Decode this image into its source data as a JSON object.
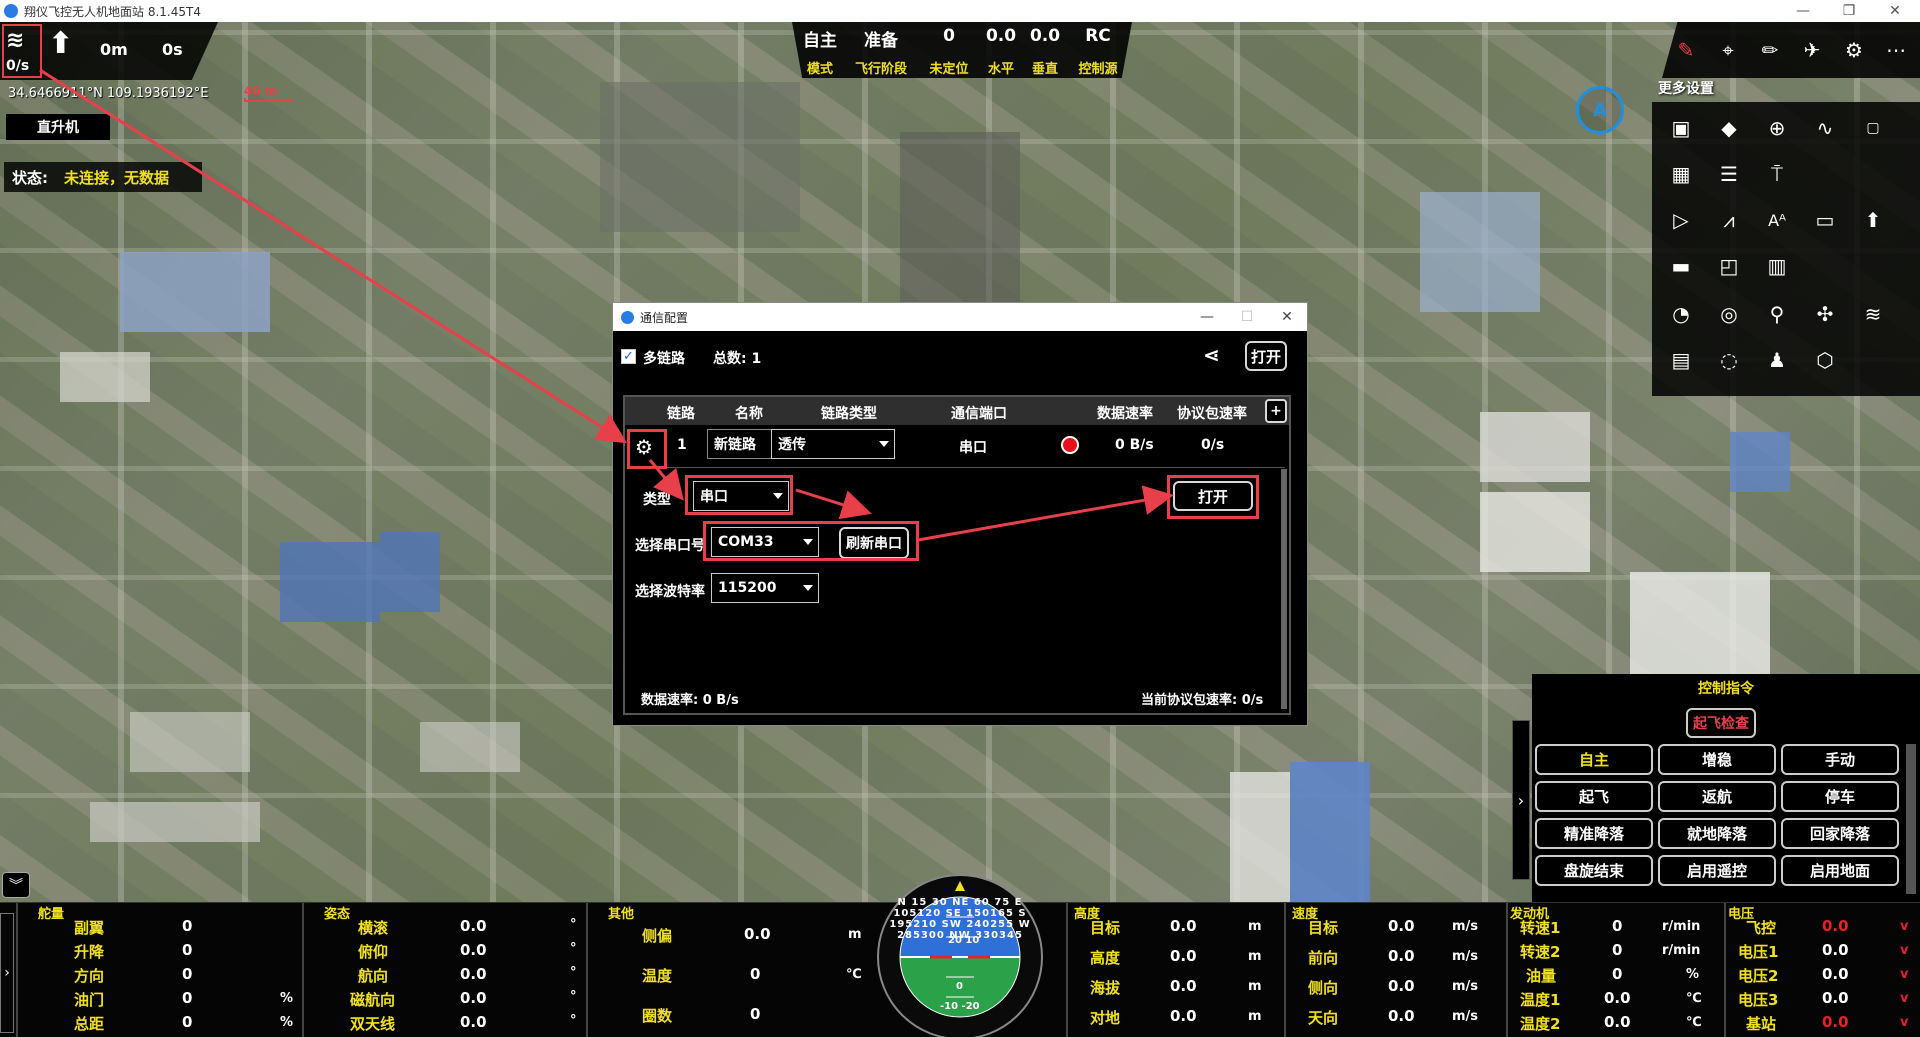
{
  "window": {
    "title": "翔仪飞控无人机地面站 8.1.45T4",
    "minimize": "—",
    "restore": "❐",
    "close": "✕"
  },
  "topleft": {
    "link_rate": "0/s",
    "altitude": "0m",
    "time": "0s",
    "coords": "34.6466911°N 109.1936192°E",
    "scale": "40 m",
    "vehicle_type": "直升机",
    "status_label": "状态:",
    "status_value": "未连接，无数据"
  },
  "topcenter": {
    "items": [
      {
        "value": "自主",
        "label": "模式"
      },
      {
        "value": "准备",
        "label": "飞行阶段"
      },
      {
        "value": "0",
        "label": "未定位"
      },
      {
        "value": "0.0",
        "label": "水平"
      },
      {
        "value": "0.0",
        "label": "垂直"
      },
      {
        "value": "RC",
        "label": "控制源"
      }
    ]
  },
  "topright": {
    "more_settings": "更多设置",
    "compass_letter": "A",
    "icon_rows": [
      [
        "settings-chip-icon",
        "diamond-icon",
        "crosshair-icon",
        "waveform-icon",
        "fc-icon"
      ],
      [
        "table-icon",
        "list-icon",
        "antenna-icon"
      ],
      [
        "play-icon",
        "chart-line-icon",
        "text-size-icon",
        "monitor-icon",
        "upload-icon"
      ],
      [
        "battery-icon",
        "screen-icon",
        "bar-chart-icon"
      ],
      [
        "gauge-icon",
        "signal-icon",
        "location-icon",
        "drone-icon",
        "wireless-icon"
      ],
      [
        "window-icon",
        "chat-icon",
        "person-icon",
        "box-icon"
      ]
    ]
  },
  "dialog": {
    "title": "通信配置",
    "multi_link_label": "多链路",
    "multi_link_checked": true,
    "total_label": "总数: 1",
    "open_button": "打开",
    "table": {
      "headers": [
        "链路",
        "名称",
        "链路类型",
        "通信端口",
        "数据速率",
        "协议包速率"
      ],
      "add_button": "+",
      "row": {
        "index": "1",
        "name": "新链路",
        "link_type": "透传",
        "port": "串口",
        "data_rate": "0 B/s",
        "packet_rate": "0/s"
      }
    },
    "settings": {
      "type_label": "类型",
      "type_value": "串口",
      "port_label": "选择串口号",
      "port_value": "COM33",
      "refresh_button": "刷新串口",
      "baud_label": "选择波特率",
      "baud_value": "115200",
      "open_button": "打开"
    },
    "footer": {
      "data_rate": "数据速率: 0 B/s",
      "packet_rate": "当前协议包速率: 0/s"
    }
  },
  "control": {
    "title": "控制指令",
    "check_button": "起飞检查",
    "buttons": [
      "自主",
      "增稳",
      "手动",
      "起飞",
      "返航",
      "停车",
      "精准降落",
      "就地降落",
      "回家降落",
      "盘旋结束",
      "启用遥控",
      "启用地面"
    ]
  },
  "telemetry": {
    "rudder": {
      "title": "舵量",
      "rows": [
        {
          "label": "副翼",
          "value": "0",
          "unit": ""
        },
        {
          "label": "升降",
          "value": "0",
          "unit": ""
        },
        {
          "label": "方向",
          "value": "0",
          "unit": ""
        },
        {
          "label": "油门",
          "value": "0",
          "unit": "%"
        },
        {
          "label": "总距",
          "value": "0",
          "unit": "%"
        }
      ]
    },
    "attitude": {
      "title": "姿态",
      "rows": [
        {
          "label": "横滚",
          "value": "0.0",
          "unit": "°"
        },
        {
          "label": "俯仰",
          "value": "0.0",
          "unit": "°"
        },
        {
          "label": "航向",
          "value": "0.0",
          "unit": "°"
        },
        {
          "label": "磁航向",
          "value": "0.0",
          "unit": "°"
        },
        {
          "label": "双天线",
          "value": "0.0",
          "unit": "°"
        }
      ]
    },
    "other": {
      "title": "其他",
      "rows": [
        {
          "label": "侧偏",
          "value": "0.0",
          "unit": "m"
        },
        {
          "label": "温度",
          "value": "0",
          "unit": "℃"
        },
        {
          "label": "圈数",
          "value": "0",
          "unit": ""
        }
      ]
    },
    "altitude": {
      "title": "高度",
      "rows": [
        {
          "label": "目标",
          "value": "0.0",
          "unit": "m"
        },
        {
          "label": "高度",
          "value": "0.0",
          "unit": "m"
        },
        {
          "label": "海拔",
          "value": "0.0",
          "unit": "m"
        },
        {
          "label": "对地",
          "value": "0.0",
          "unit": "m"
        }
      ]
    },
    "speed": {
      "title": "速度",
      "rows": [
        {
          "label": "目标",
          "value": "0.0",
          "unit": "m/s"
        },
        {
          "label": "前向",
          "value": "0.0",
          "unit": "m/s"
        },
        {
          "label": "侧向",
          "value": "0.0",
          "unit": "m/s"
        },
        {
          "label": "天向",
          "value": "0.0",
          "unit": "m/s"
        }
      ]
    },
    "engine": {
      "title": "发动机",
      "rows": [
        {
          "label": "转速1",
          "value": "0",
          "unit": "r/min"
        },
        {
          "label": "转速2",
          "value": "0",
          "unit": "r/min"
        },
        {
          "label": "油量",
          "value": "0",
          "unit": "%"
        },
        {
          "label": "温度1",
          "value": "0.0",
          "unit": "℃"
        },
        {
          "label": "温度2",
          "value": "0.0",
          "unit": "℃"
        }
      ]
    },
    "voltage": {
      "title": "电压",
      "rows": [
        {
          "label": "飞控",
          "value": "0.0",
          "unit": "v",
          "red": true
        },
        {
          "label": "电压1",
          "value": "0.0",
          "unit": "v"
        },
        {
          "label": "电压2",
          "value": "0.0",
          "unit": "v"
        },
        {
          "label": "电压3",
          "value": "0.0",
          "unit": "v"
        },
        {
          "label": "基站",
          "value": "0.0",
          "unit": "v",
          "red": true
        }
      ]
    },
    "hsi": {
      "compass_ring": "N 15 30 NE 60 75 E 105120 SE 150165 S 195210 SW 240255 W 285300 NW 330345",
      "pitch_up": "20 10",
      "pitch_down": "-10 -20",
      "center": "0"
    }
  }
}
